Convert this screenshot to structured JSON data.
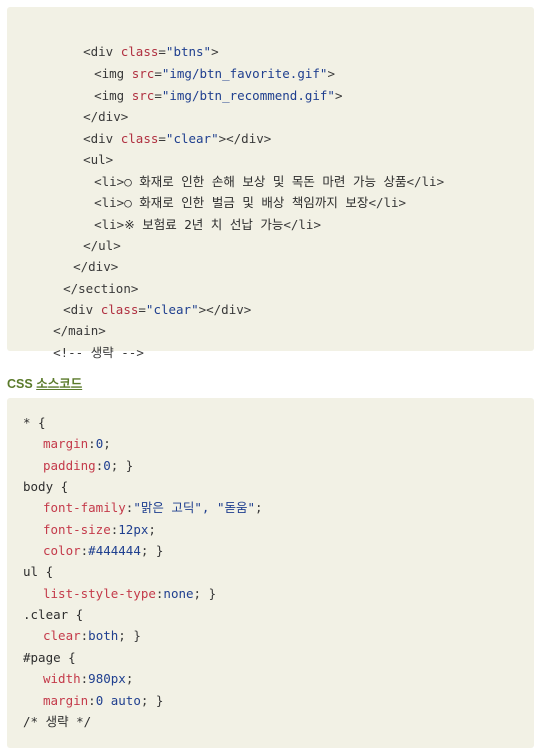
{
  "html_code": {
    "lines": [
      [
        "<div ",
        "class",
        "=",
        "\"btns\"",
        ">"
      ],
      [
        "<img ",
        "src",
        "=",
        "\"img/btn_favorite.gif\"",
        ">"
      ],
      [
        "<img ",
        "src",
        "=",
        "\"img/btn_recommend.gif\"",
        ">"
      ],
      [
        "</div>"
      ],
      [
        "<div ",
        "class",
        "=",
        "\"clear\"",
        "></div>"
      ],
      [
        "<ul>"
      ],
      [
        "<li>",
        "○ 화재로 인한 손해 보상 및 목돈 마련 가능 상품",
        "</li>"
      ],
      [
        "<li>",
        "○ 화재로 인한 벌금 및 배상 책임까지 보장",
        "</li>"
      ],
      [
        "<li>",
        "※ 보험료 2년 치 선납 가능",
        "</li>"
      ],
      [
        "</ul>"
      ],
      [
        "</div>"
      ],
      [
        "</section>"
      ],
      [
        "<div ",
        "class",
        "=",
        "\"clear\"",
        "></div>"
      ],
      [
        "</main>"
      ],
      [
        "<!-- 생략 -->"
      ]
    ]
  },
  "css_heading": {
    "prefix": "CSS ",
    "underlined": "소스코드"
  },
  "css_code": {
    "line0": "* {",
    "line1_prop": "margin",
    "line1_val": "0",
    "line2_prop": "padding",
    "line2_val": "0",
    "line3": "body {",
    "line4_prop": "font-family",
    "line4_val": "\"맑은 고딕\", \"돋움\"",
    "line5_prop": "font-size",
    "line5_val": "12px",
    "line6_prop": "color",
    "line6_val": "#444444",
    "line7": "ul {",
    "line8_prop": "list-style-type",
    "line8_val": "none",
    "line9": ".clear {",
    "line10_prop": "clear",
    "line10_val": "both",
    "line11": "#page {",
    "line12_prop": "width",
    "line12_val": "980px",
    "line13_prop": "margin",
    "line13_val": "0 auto",
    "line14": "/* 생략 */"
  }
}
